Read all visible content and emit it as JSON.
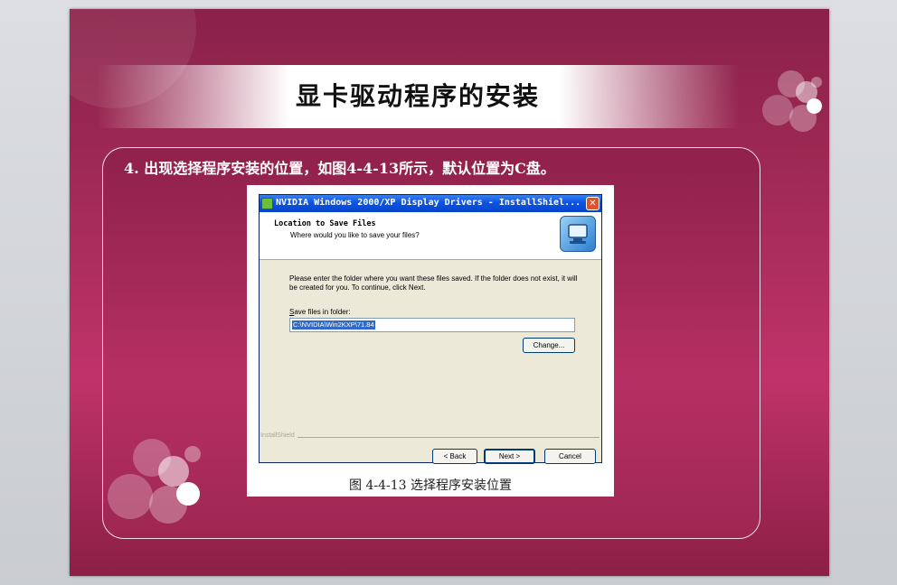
{
  "slide": {
    "title": "显卡驱动程序的安装",
    "step_text": "4. 出现选择程序安装的位置，如图4-4-13所示，默认位置为C盘。"
  },
  "dialog": {
    "window_title": "NVIDIA Windows 2000/XP Display Drivers - InstallShiel...",
    "close_glyph": "✕",
    "header_title": "Location to Save Files",
    "header_subtitle": "Where would you like to save your files?",
    "instruction": "Please enter the folder where you want these files saved.  If the folder does not exist, it will be created for you.   To continue, click Next.",
    "folder_label_prefix": "S",
    "folder_label_rest": "ave files in folder:",
    "folder_value": "C:\\NVIDIA\\Win2KXP\\71.84",
    "change_button": "Change...",
    "installshield_label": "InstallShield",
    "back_button": "< Back",
    "next_button": "Next >",
    "cancel_button": "Cancel"
  },
  "figure": {
    "caption": "图 4-4-13  选择程序安装位置"
  },
  "colors": {
    "slide_bg": "#a02a55",
    "titlebar_blue": "#0a54e3",
    "selection_blue": "#316ac5"
  },
  "icons": [
    "nvidia-app-icon",
    "close-icon",
    "computer-install-icon"
  ]
}
